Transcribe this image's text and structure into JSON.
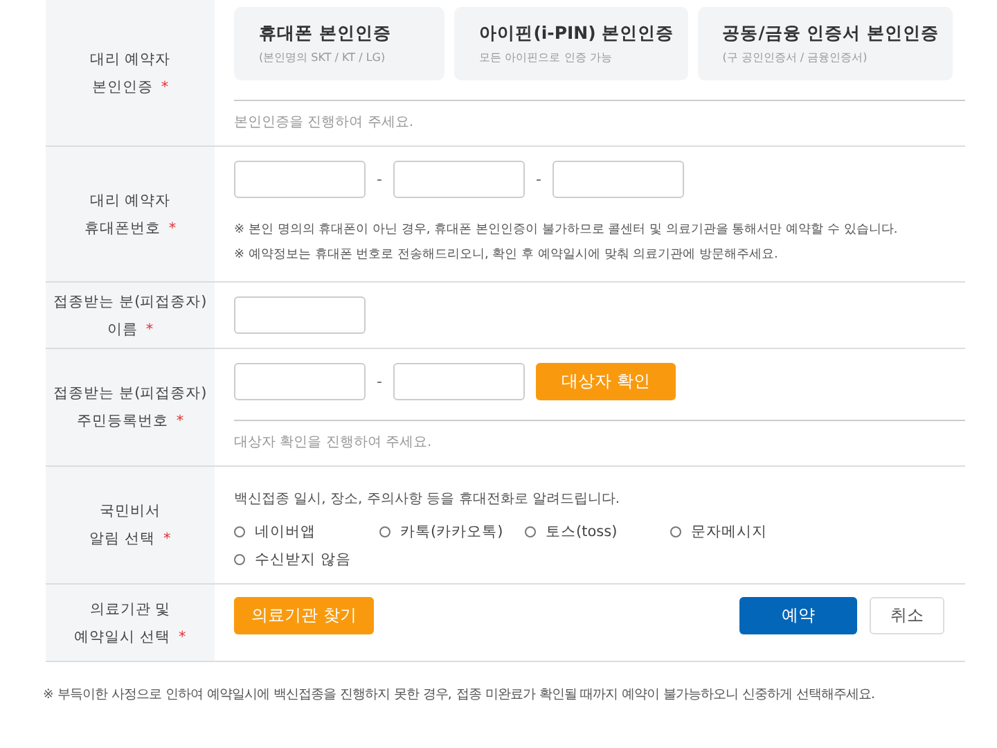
{
  "rows": [
    {
      "kind": "auth",
      "label": [
        "대리 예약자",
        "본인인증"
      ],
      "required": true,
      "options": [
        {
          "title": "휴대폰 본인인증",
          "subtitle": "(본인명의 SKT / KT / LG)"
        },
        {
          "title": "아이핀(i-PIN) 본인인증",
          "subtitle": "모든 아이핀으로 인증 가능"
        },
        {
          "title": "공동/금융 인증서 본인인증",
          "subtitle": "(구 공인인증서 / 금융인증서)"
        }
      ],
      "status": "본인인증을 진행하여 주세요."
    },
    {
      "kind": "phone",
      "label": [
        "대리 예약자",
        "휴대폰번호"
      ],
      "required": true,
      "separators": [
        "-",
        "-"
      ],
      "notes": [
        "※ 본인 명의의 휴대폰이 아닌 경우, 휴대폰 본인인증이 불가하므로 콜센터 및 의료기관을 통해서만 예약할 수 있습니다.",
        "※ 예약정보는 휴대폰 번호로 전송해드리오니, 확인 후 예약일시에 맞춰 의료기관에 방문해주세요."
      ]
    },
    {
      "kind": "name",
      "label": [
        "접종받는 분(피접종자)",
        "이름"
      ],
      "required": true
    },
    {
      "kind": "id",
      "label": [
        "접종받는 분(피접종자)",
        "주민등록번호"
      ],
      "required": true,
      "separators": [
        "-"
      ],
      "button": "대상자 확인",
      "status": "대상자 확인을 진행하여 주세요."
    },
    {
      "kind": "notify",
      "label": [
        "국민비서",
        "알림 선택"
      ],
      "required": true,
      "intro": "백신접종 일시, 장소, 주의사항 등을 휴대전화로 알려드립니다.",
      "options": [
        {
          "label": "네이버앱",
          "selected": false
        },
        {
          "label": "카톡(카카오톡)",
          "selected": false
        },
        {
          "label": "토스(toss)",
          "selected": false
        },
        {
          "label": "문자메시지",
          "selected": false
        },
        {
          "label": "수신받지 않음",
          "selected": false
        }
      ]
    },
    {
      "kind": "hospital",
      "label": [
        "의료기관 및",
        "예약일시 선택"
      ],
      "required": true,
      "button": "의료기관 찾기",
      "submit": "예약",
      "cancel": "취소"
    }
  ],
  "required_mark": "*",
  "footer_note": "※ 부득이한 사정으로 인하여 예약일시에 백신접종을 진행하지 못한 경우, 접종 미완료가 확인될 때까지 예약이 불가능하오니 신중하게 선택해주세요."
}
